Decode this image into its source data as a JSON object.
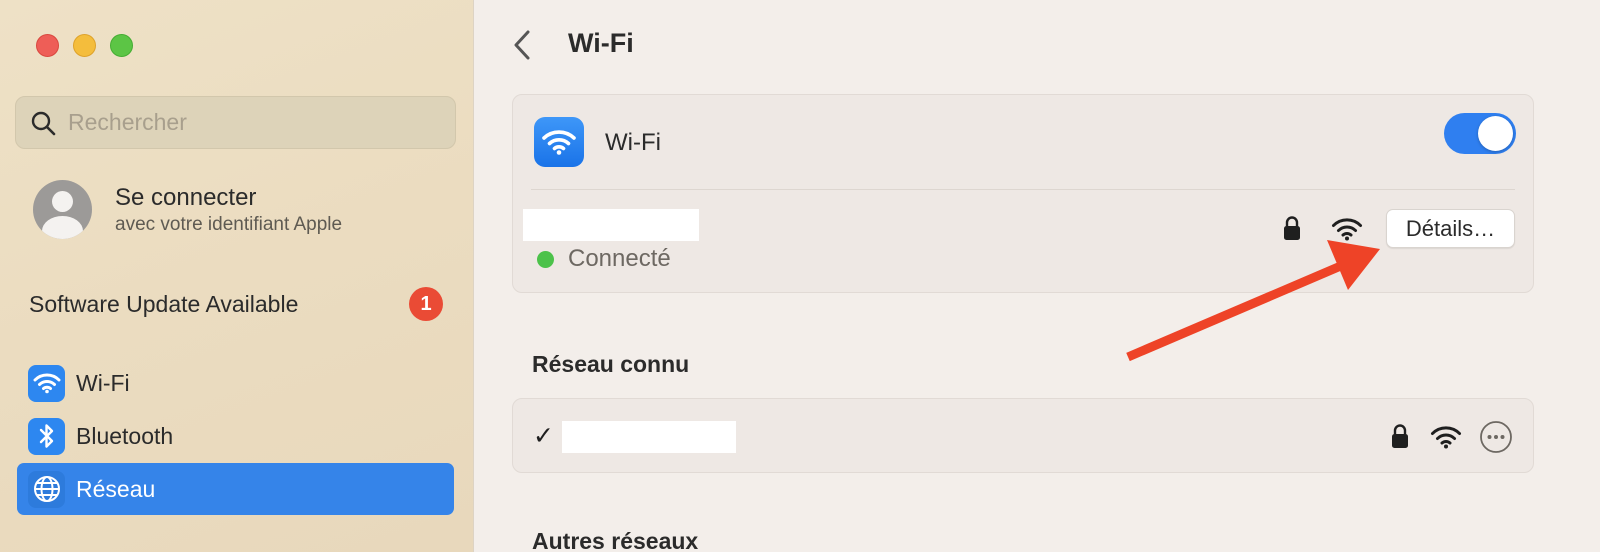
{
  "window": {
    "controls": [
      "close",
      "minimize",
      "zoom"
    ]
  },
  "sidebar": {
    "search": {
      "placeholder": "Rechercher",
      "value": ""
    },
    "account": {
      "title": "Se connecter",
      "subtitle": "avec votre identifiant Apple"
    },
    "update": {
      "label": "Software Update Available",
      "badge": "1"
    },
    "items": [
      {
        "label": "Wi-Fi",
        "icon": "wifi-icon",
        "active": false
      },
      {
        "label": "Bluetooth",
        "icon": "bluetooth-icon",
        "active": false
      },
      {
        "label": "Réseau",
        "icon": "globe-icon",
        "active": true
      }
    ]
  },
  "main": {
    "title": "Wi-Fi",
    "wifi_card": {
      "label": "Wi-Fi",
      "toggle_on": true,
      "network_status": "Connecté",
      "details_label": "Détails…"
    },
    "known_networks": {
      "title": "Réseau connu"
    },
    "other_networks": {
      "title": "Autres réseaux"
    }
  },
  "colors": {
    "accent": "#3584e9",
    "toggle": "#2f7ff0",
    "connected": "#4cc24a",
    "badge": "#ea4b35",
    "annotation_arrow": "#ee4327"
  }
}
